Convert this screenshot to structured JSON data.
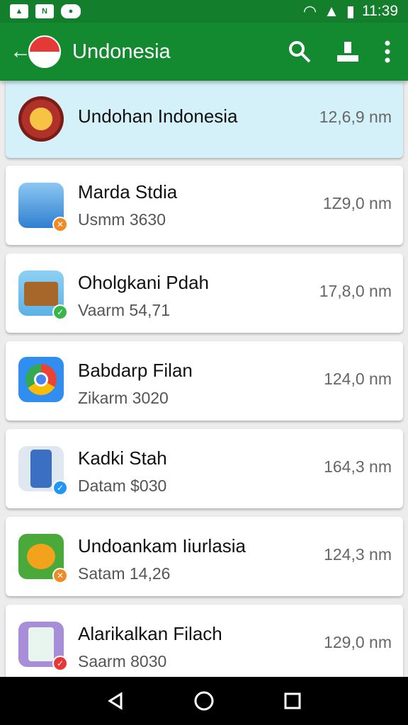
{
  "status_bar": {
    "icons": [
      "image-icon",
      "signal-icon",
      "message-icon"
    ],
    "time": "11:39"
  },
  "app_bar": {
    "title": "Undonesia"
  },
  "header_item": {
    "title": "Undohan Indonesia",
    "size": "12,6,9 nm"
  },
  "items": [
    {
      "title": "Marda Stdia",
      "subtitle": "Usmm  3630",
      "size": "1Z9,0 nm",
      "icon": "person-icon",
      "badge": "orange"
    },
    {
      "title": "Oholgkani Pdah",
      "subtitle": "Vaarm  54,71",
      "size": "17,8,0 nm",
      "icon": "box-icon",
      "badge": "green"
    },
    {
      "title": "Babdarp Filan",
      "subtitle": "Zikarm  3020",
      "size": "124,0 nm",
      "icon": "chrome-icon",
      "badge": ""
    },
    {
      "title": "Kadki Stah",
      "subtitle": "Datam  $030",
      "size": "164,3 nm",
      "icon": "phone-icon",
      "badge": "blue"
    },
    {
      "title": "Undoankam Iiurlasia",
      "subtitle": "Satam  14,26",
      "size": "124,3 nm",
      "icon": "cat-icon",
      "badge": "orange"
    },
    {
      "title": "Alarikalkan Filach",
      "subtitle": "Saarm  8030",
      "size": "129,0 nm",
      "icon": "tablet-icon",
      "badge": "red"
    }
  ]
}
